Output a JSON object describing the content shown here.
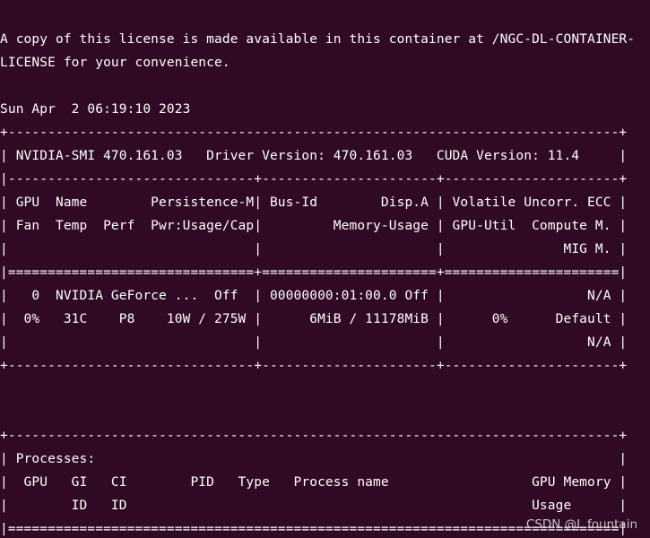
{
  "terminal": {
    "background": "#300a24",
    "foreground": "#ffffff",
    "lines": [
      "",
      "A copy of this license is made available in this container at /NGC-DL-CONTAINER-",
      "LICENSE for your convenience.",
      "",
      "Sun Apr  2 06:19:10 2023",
      "+-----------------------------------------------------------------------------+",
      "| NVIDIA-SMI 470.161.03   Driver Version: 470.161.03   CUDA Version: 11.4     |",
      "|-------------------------------+----------------------+----------------------+",
      "| GPU  Name        Persistence-M| Bus-Id        Disp.A | Volatile Uncorr. ECC |",
      "| Fan  Temp  Perf  Pwr:Usage/Cap|         Memory-Usage | GPU-Util  Compute M. |",
      "|                               |                      |               MIG M. |",
      "|===============================+======================+======================|",
      "|   0  NVIDIA GeForce ...  Off  | 00000000:01:00.0 Off |                  N/A |",
      "|  0%   31C    P8    10W / 275W |      6MiB / 11178MiB |      0%      Default |",
      "|                               |                      |                  N/A |",
      "+-------------------------------+----------------------+----------------------+",
      "",
      "",
      "+-----------------------------------------------------------------------------+",
      "| Processes:                                                                  |",
      "|  GPU   GI   CI        PID   Type   Process name                  GPU Memory |",
      "|        ID   ID                                                   Usage      |",
      "|=============================================================================|",
      "+-----------------------------------------------------------------------------+"
    ]
  },
  "watermark": {
    "text": "CSDN @L.fountain"
  }
}
